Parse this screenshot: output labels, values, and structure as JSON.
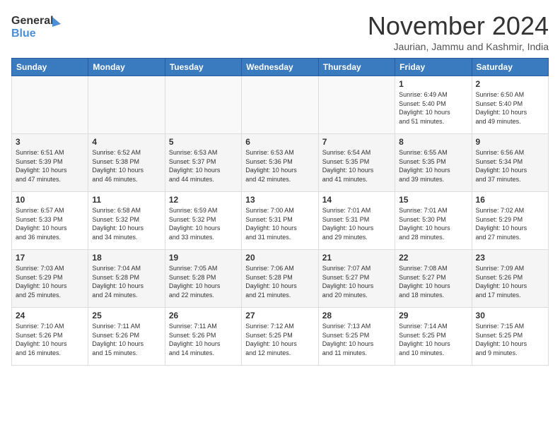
{
  "logo": {
    "line1": "General",
    "line2": "Blue"
  },
  "title": "November 2024",
  "location": "Jaurian, Jammu and Kashmir, India",
  "days_of_week": [
    "Sunday",
    "Monday",
    "Tuesday",
    "Wednesday",
    "Thursday",
    "Friday",
    "Saturday"
  ],
  "weeks": [
    [
      {
        "day": "",
        "info": ""
      },
      {
        "day": "",
        "info": ""
      },
      {
        "day": "",
        "info": ""
      },
      {
        "day": "",
        "info": ""
      },
      {
        "day": "",
        "info": ""
      },
      {
        "day": "1",
        "info": "Sunrise: 6:49 AM\nSunset: 5:40 PM\nDaylight: 10 hours\nand 51 minutes."
      },
      {
        "day": "2",
        "info": "Sunrise: 6:50 AM\nSunset: 5:40 PM\nDaylight: 10 hours\nand 49 minutes."
      }
    ],
    [
      {
        "day": "3",
        "info": "Sunrise: 6:51 AM\nSunset: 5:39 PM\nDaylight: 10 hours\nand 47 minutes."
      },
      {
        "day": "4",
        "info": "Sunrise: 6:52 AM\nSunset: 5:38 PM\nDaylight: 10 hours\nand 46 minutes."
      },
      {
        "day": "5",
        "info": "Sunrise: 6:53 AM\nSunset: 5:37 PM\nDaylight: 10 hours\nand 44 minutes."
      },
      {
        "day": "6",
        "info": "Sunrise: 6:53 AM\nSunset: 5:36 PM\nDaylight: 10 hours\nand 42 minutes."
      },
      {
        "day": "7",
        "info": "Sunrise: 6:54 AM\nSunset: 5:35 PM\nDaylight: 10 hours\nand 41 minutes."
      },
      {
        "day": "8",
        "info": "Sunrise: 6:55 AM\nSunset: 5:35 PM\nDaylight: 10 hours\nand 39 minutes."
      },
      {
        "day": "9",
        "info": "Sunrise: 6:56 AM\nSunset: 5:34 PM\nDaylight: 10 hours\nand 37 minutes."
      }
    ],
    [
      {
        "day": "10",
        "info": "Sunrise: 6:57 AM\nSunset: 5:33 PM\nDaylight: 10 hours\nand 36 minutes."
      },
      {
        "day": "11",
        "info": "Sunrise: 6:58 AM\nSunset: 5:32 PM\nDaylight: 10 hours\nand 34 minutes."
      },
      {
        "day": "12",
        "info": "Sunrise: 6:59 AM\nSunset: 5:32 PM\nDaylight: 10 hours\nand 33 minutes."
      },
      {
        "day": "13",
        "info": "Sunrise: 7:00 AM\nSunset: 5:31 PM\nDaylight: 10 hours\nand 31 minutes."
      },
      {
        "day": "14",
        "info": "Sunrise: 7:01 AM\nSunset: 5:31 PM\nDaylight: 10 hours\nand 29 minutes."
      },
      {
        "day": "15",
        "info": "Sunrise: 7:01 AM\nSunset: 5:30 PM\nDaylight: 10 hours\nand 28 minutes."
      },
      {
        "day": "16",
        "info": "Sunrise: 7:02 AM\nSunset: 5:29 PM\nDaylight: 10 hours\nand 27 minutes."
      }
    ],
    [
      {
        "day": "17",
        "info": "Sunrise: 7:03 AM\nSunset: 5:29 PM\nDaylight: 10 hours\nand 25 minutes."
      },
      {
        "day": "18",
        "info": "Sunrise: 7:04 AM\nSunset: 5:28 PM\nDaylight: 10 hours\nand 24 minutes."
      },
      {
        "day": "19",
        "info": "Sunrise: 7:05 AM\nSunset: 5:28 PM\nDaylight: 10 hours\nand 22 minutes."
      },
      {
        "day": "20",
        "info": "Sunrise: 7:06 AM\nSunset: 5:28 PM\nDaylight: 10 hours\nand 21 minutes."
      },
      {
        "day": "21",
        "info": "Sunrise: 7:07 AM\nSunset: 5:27 PM\nDaylight: 10 hours\nand 20 minutes."
      },
      {
        "day": "22",
        "info": "Sunrise: 7:08 AM\nSunset: 5:27 PM\nDaylight: 10 hours\nand 18 minutes."
      },
      {
        "day": "23",
        "info": "Sunrise: 7:09 AM\nSunset: 5:26 PM\nDaylight: 10 hours\nand 17 minutes."
      }
    ],
    [
      {
        "day": "24",
        "info": "Sunrise: 7:10 AM\nSunset: 5:26 PM\nDaylight: 10 hours\nand 16 minutes."
      },
      {
        "day": "25",
        "info": "Sunrise: 7:11 AM\nSunset: 5:26 PM\nDaylight: 10 hours\nand 15 minutes."
      },
      {
        "day": "26",
        "info": "Sunrise: 7:11 AM\nSunset: 5:26 PM\nDaylight: 10 hours\nand 14 minutes."
      },
      {
        "day": "27",
        "info": "Sunrise: 7:12 AM\nSunset: 5:25 PM\nDaylight: 10 hours\nand 12 minutes."
      },
      {
        "day": "28",
        "info": "Sunrise: 7:13 AM\nSunset: 5:25 PM\nDaylight: 10 hours\nand 11 minutes."
      },
      {
        "day": "29",
        "info": "Sunrise: 7:14 AM\nSunset: 5:25 PM\nDaylight: 10 hours\nand 10 minutes."
      },
      {
        "day": "30",
        "info": "Sunrise: 7:15 AM\nSunset: 5:25 PM\nDaylight: 10 hours\nand 9 minutes."
      }
    ]
  ]
}
